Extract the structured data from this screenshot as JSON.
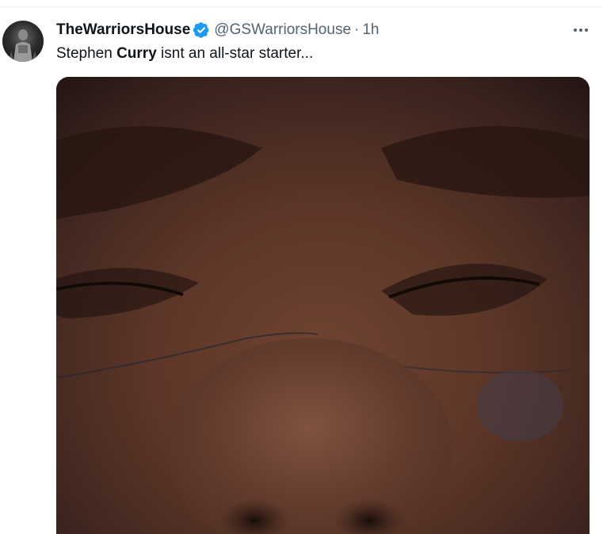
{
  "tweet": {
    "author": {
      "display_name": "TheWarriorsHouse",
      "handle": "@GSWarriorsHouse",
      "verified": true
    },
    "separator": "·",
    "time": "1h",
    "text": {
      "before": "Stephen ",
      "bold": "Curry",
      "after": " isnt an all-star starter..."
    },
    "media": {
      "type": "image"
    }
  },
  "icons": {
    "verified": "verified-badge-icon",
    "more": "more-horizontal-icon"
  },
  "colors": {
    "verified_blue": "#1d9bf0",
    "text_primary": "#0f1419",
    "text_secondary": "#536471"
  }
}
